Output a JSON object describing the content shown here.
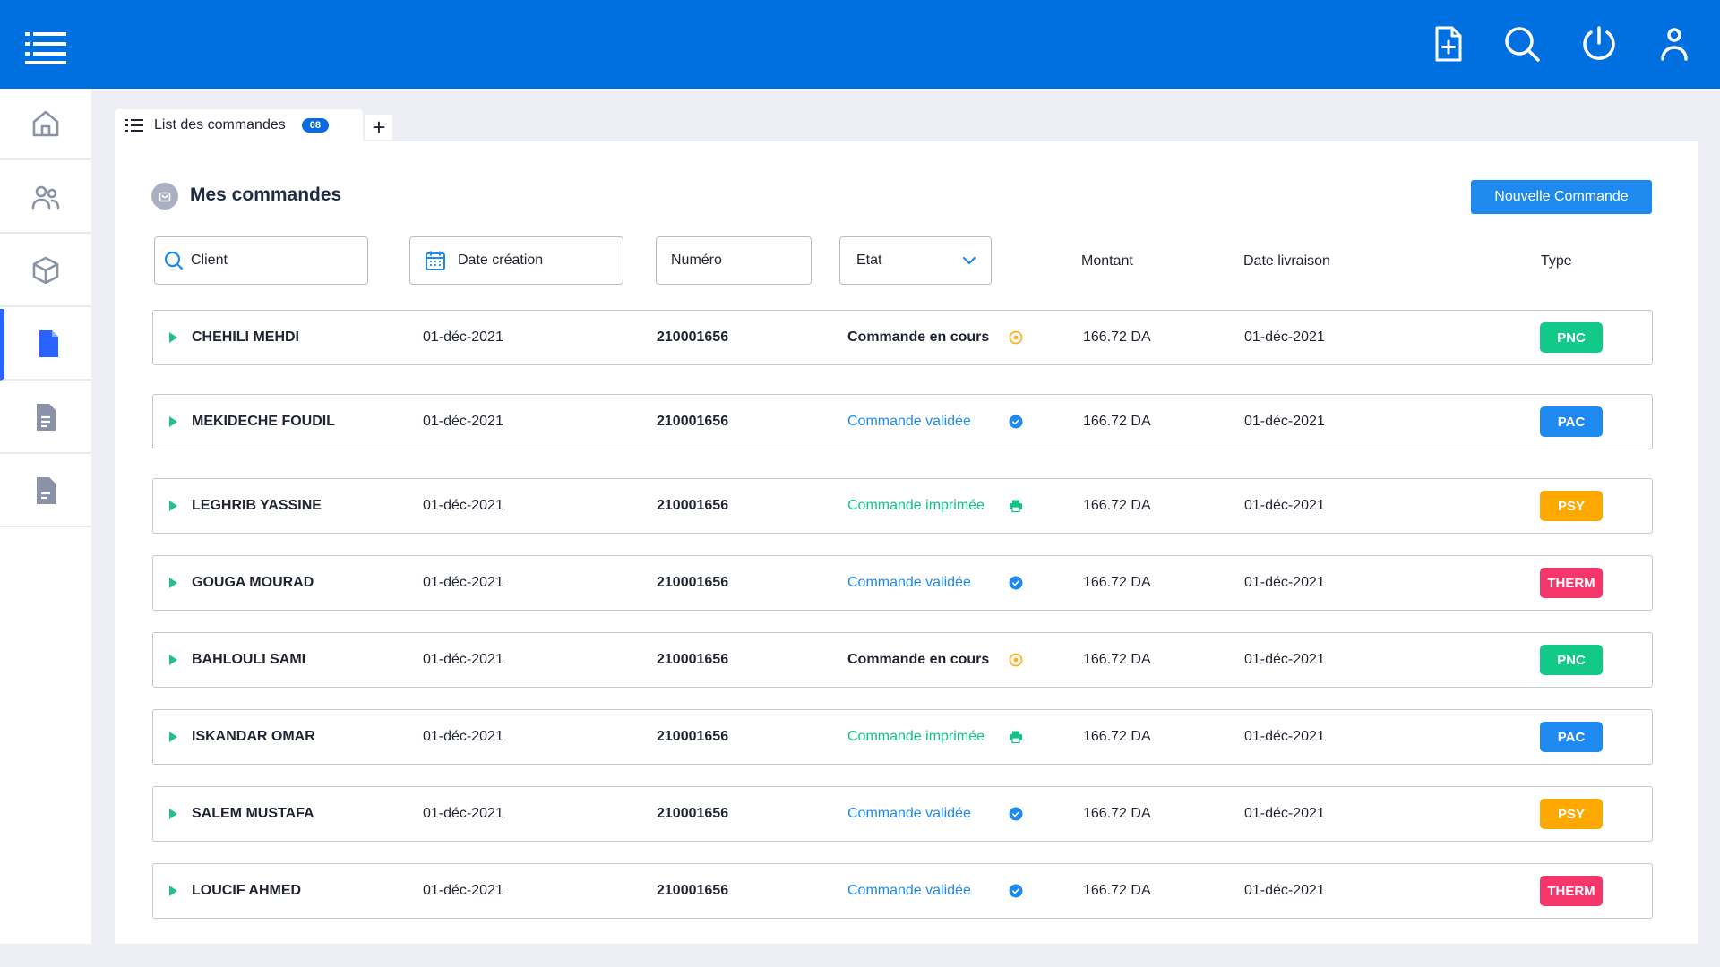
{
  "tab": {
    "label": "List des commandes",
    "badge": "08",
    "add": "+"
  },
  "panel": {
    "title": "Mes commandes",
    "new_button": "Nouvelle Commande"
  },
  "filters": {
    "client": "Client",
    "date_creation": "Date création",
    "numero": "Numéro",
    "etat": "Etat",
    "montant": "Montant",
    "date_livraison": "Date livraison",
    "type": "Type"
  },
  "status_colors": {
    "en_cours": "#1f2430",
    "validee": "#1e8af0",
    "imprimee": "#12c28a"
  },
  "type_colors": {
    "PNC": "#12c98a",
    "PAC": "#1e8af0",
    "PSY": "#ffa800",
    "THERM": "#f5366a"
  },
  "orders": [
    {
      "client": "CHEHILI MEHDI",
      "date": "01-déc-2021",
      "numero": "210001656",
      "status": "Commande en cours",
      "status_kind": "en_cours",
      "status_icon": "clock-icon",
      "amount": "166.72 DA",
      "delivery": "01-déc-2021",
      "type": "PNC"
    },
    {
      "client": "MEKIDECHE FOUDIL",
      "date": "01-déc-2021",
      "numero": "210001656",
      "status": "Commande validée",
      "status_kind": "validee",
      "status_icon": "check-circle-icon",
      "amount": "166.72 DA",
      "delivery": "01-déc-2021",
      "type": "PAC"
    },
    {
      "client": "LEGHRIB YASSINE",
      "date": "01-déc-2021",
      "numero": "210001656",
      "status": "Commande imprimée",
      "status_kind": "imprimee",
      "status_icon": "printer-icon",
      "amount": "166.72 DA",
      "delivery": "01-déc-2021",
      "type": "PSY"
    },
    {
      "client": "GOUGA MOURAD",
      "date": "01-déc-2021",
      "numero": "210001656",
      "status": "Commande validée",
      "status_kind": "validee",
      "status_icon": "check-circle-icon",
      "amount": "166.72 DA",
      "delivery": "01-déc-2021",
      "type": "THERM"
    },
    {
      "client": "BAHLOULI SAMI",
      "date": "01-déc-2021",
      "numero": "210001656",
      "status": "Commande en cours",
      "status_kind": "en_cours",
      "status_icon": "clock-icon",
      "amount": "166.72 DA",
      "delivery": "01-déc-2021",
      "type": "PNC"
    },
    {
      "client": "ISKANDAR OMAR",
      "date": "01-déc-2021",
      "numero": "210001656",
      "status": "Commande imprimée",
      "status_kind": "imprimee",
      "status_icon": "printer-icon",
      "amount": "166.72 DA",
      "delivery": "01-déc-2021",
      "type": "PAC"
    },
    {
      "client": "SALEM MUSTAFA",
      "date": "01-déc-2021",
      "numero": "210001656",
      "status": "Commande validée",
      "status_kind": "validee",
      "status_icon": "check-circle-icon",
      "amount": "166.72 DA",
      "delivery": "01-déc-2021",
      "type": "PSY"
    },
    {
      "client": "LOUCIF AHMED",
      "date": "01-déc-2021",
      "numero": "210001656",
      "status": "Commande validée",
      "status_kind": "validee",
      "status_icon": "check-circle-icon",
      "amount": "166.72 DA",
      "delivery": "01-déc-2021",
      "type": "THERM"
    }
  ]
}
